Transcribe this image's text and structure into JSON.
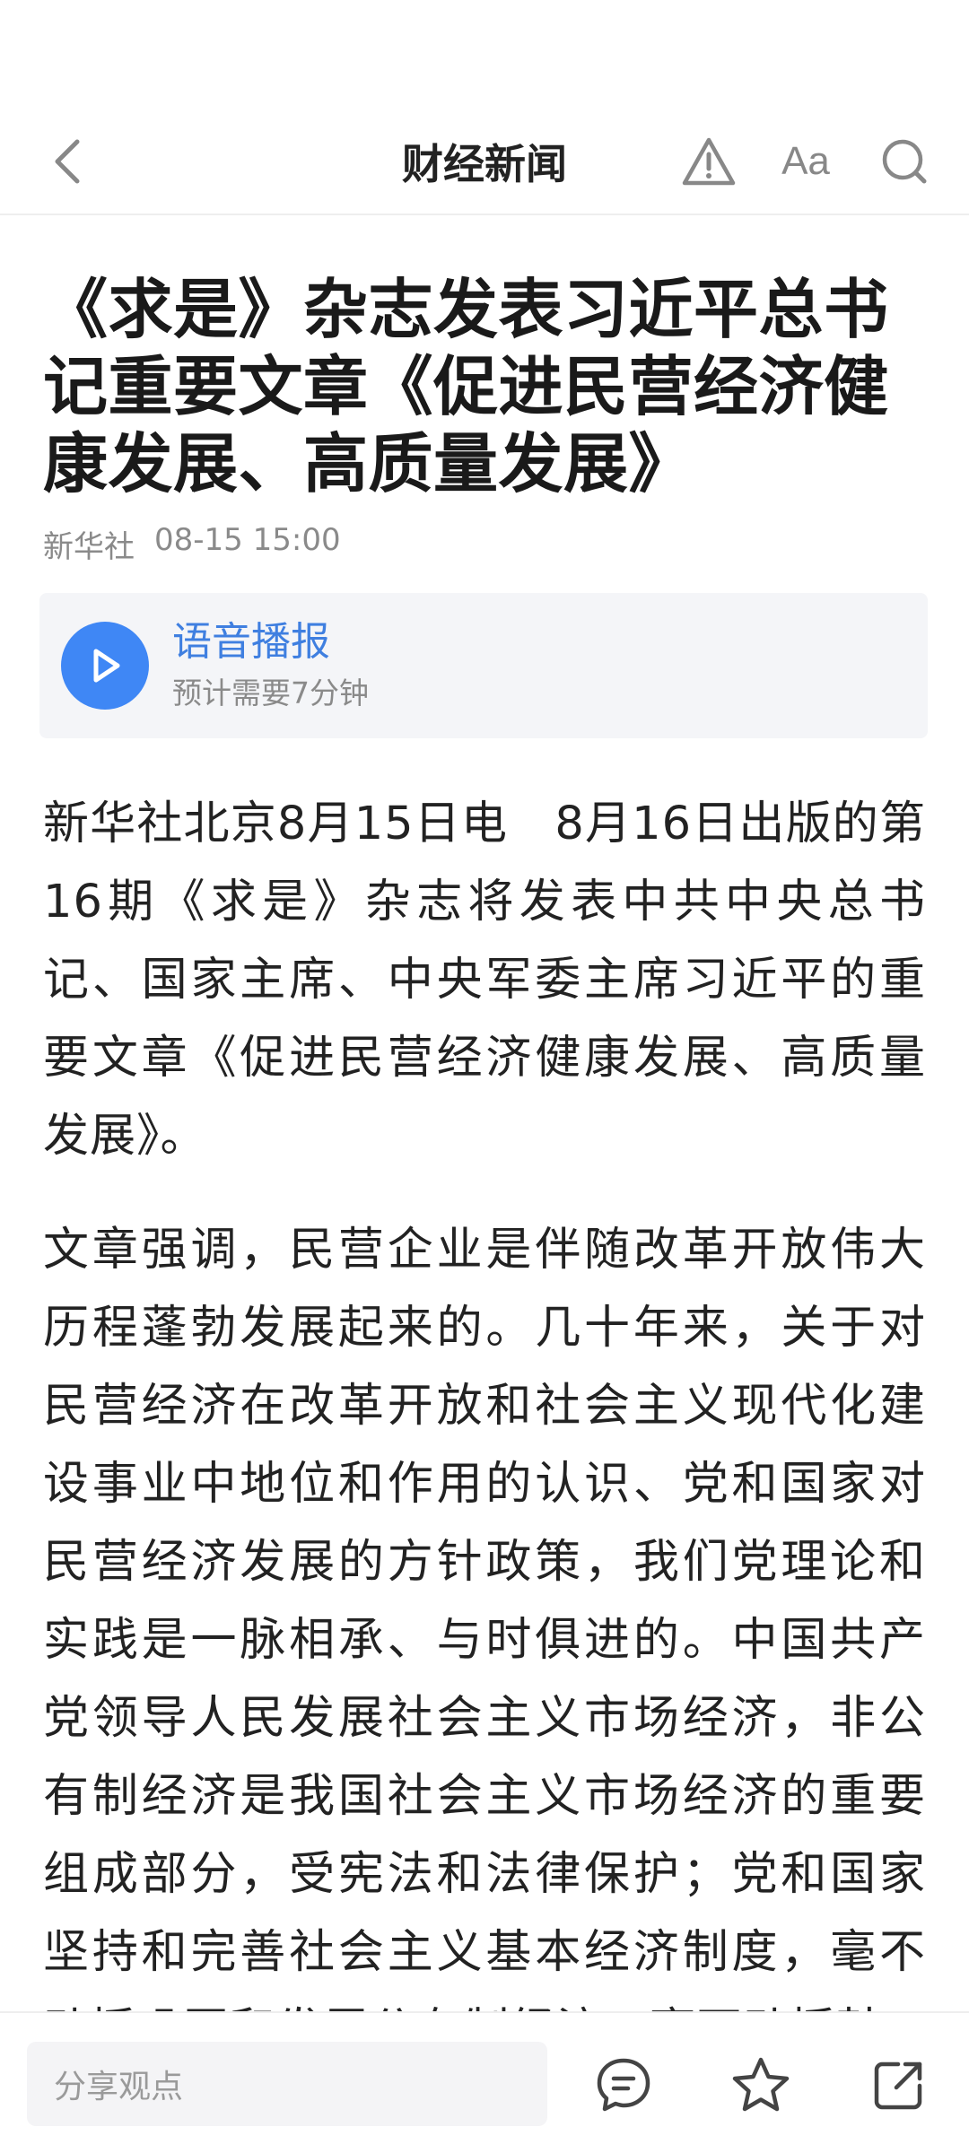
{
  "header": {
    "title": "财经新闻",
    "font_label": "Aa"
  },
  "article": {
    "title": "《求是》杂志发表习近平总书记重要文章《促进民营经济健康发展、高质量发展》",
    "source": "新华社",
    "time": "08-15 15:00",
    "paragraphs": [
      "新华社北京8月15日电　8月16日出版的第16期《求是》杂志将发表中共中央总书记、国家主席、中央军委主席习近平的重要文章《促进民营经济健康发展、高质量发展》。",
      "文章强调，民营企业是伴随改革开放伟大历程蓬勃发展起来的。几十年来，关于对民营经济在改革开放和社会主义现代化建设事业中地位和作用的认识、党和国家对民营经济发展的方针政策，我们党理论和实践是一脉相承、与时俱进的。中国共产党领导人民发展社会主义市场经济，非公有制经济是我国社会主义市场经济的重要组成部分，受宪法和法律保护；党和国家坚持和完善社会主义基本经济制度，毫不动摇巩固和发展公有制经济，毫不动摇鼓"
    ]
  },
  "audio": {
    "title": "语音播报",
    "subtitle": "预计需要7分钟"
  },
  "bottom_bar": {
    "comment_placeholder": "分享观点"
  },
  "colors": {
    "accent": "#3f87f5",
    "accent_text": "#3f7fe0",
    "icon_gray": "#888888",
    "meta_gray": "#8a8a8a"
  }
}
